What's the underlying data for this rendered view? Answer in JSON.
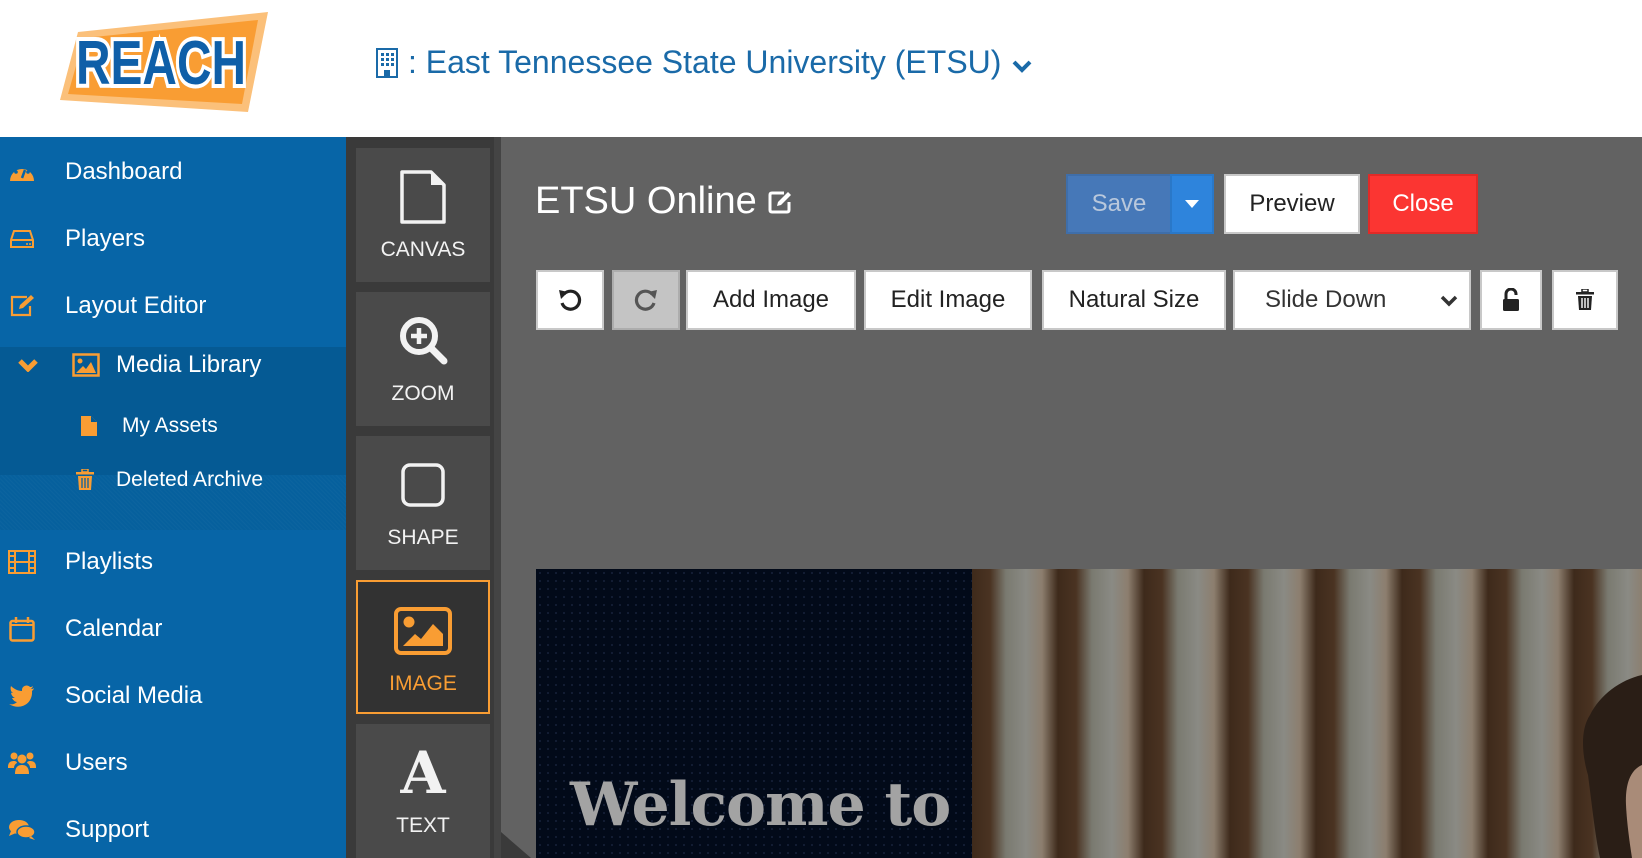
{
  "header": {
    "logo_text": "REACH",
    "org_prefix": ":",
    "org_name": "East Tennessee State University (ETSU)",
    "org_icon": "building-icon"
  },
  "sidebar": {
    "items": [
      {
        "label": "Dashboard",
        "icon": "dashboard-icon"
      },
      {
        "label": "Players",
        "icon": "hdd-icon"
      },
      {
        "label": "Layout Editor",
        "icon": "edit-icon"
      },
      {
        "label": "Media Library",
        "icon": "image-icon",
        "expanded": true
      },
      {
        "label": "Playlists",
        "icon": "film-icon"
      },
      {
        "label": "Calendar",
        "icon": "calendar-icon"
      },
      {
        "label": "Social Media",
        "icon": "twitter-icon"
      },
      {
        "label": "Users",
        "icon": "users-icon"
      },
      {
        "label": "Support",
        "icon": "comments-icon"
      }
    ],
    "media_sub": [
      {
        "label": "My Assets",
        "icon": "file-icon"
      },
      {
        "label": "Deleted Archive",
        "icon": "trash-icon"
      }
    ]
  },
  "tools": [
    {
      "label": "CANVAS",
      "icon": "file-icon"
    },
    {
      "label": "ZOOM",
      "icon": "zoom-in-icon"
    },
    {
      "label": "SHAPE",
      "icon": "square-icon"
    },
    {
      "label": "IMAGE",
      "icon": "image-icon",
      "active": true
    },
    {
      "label": "TEXT",
      "icon": "font-icon"
    }
  ],
  "editor": {
    "title": "ETSU Online",
    "save_label": "Save",
    "preview_label": "Preview",
    "close_label": "Close",
    "toolbar": {
      "add_image": "Add Image",
      "edit_image": "Edit Image",
      "natural_size": "Natural Size",
      "transition_selected": "Slide Down"
    }
  },
  "canvas": {
    "headline": "Welcome to"
  },
  "colors": {
    "brand_blue": "#0765a7",
    "accent_orange": "#f99d33",
    "close_red": "#fb3532",
    "save_blue": "#4678b8"
  }
}
